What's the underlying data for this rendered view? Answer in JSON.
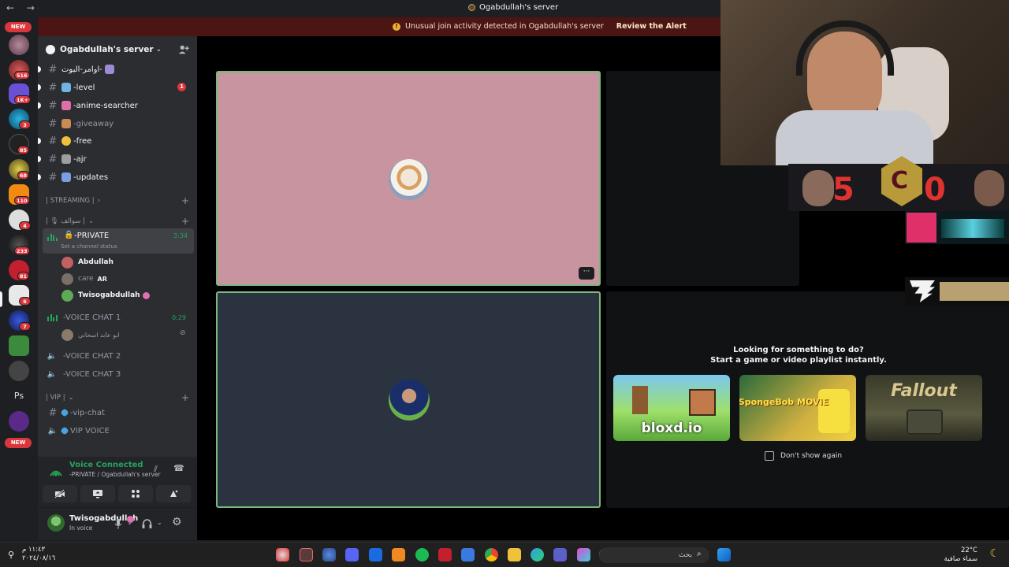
{
  "window": {
    "title": "Ogabdullah's server",
    "nav_arrows": "← →"
  },
  "alert": {
    "message": "Unusual join activity detected in Ogabdullah's server",
    "action": "Review the Alert"
  },
  "rail": {
    "badges": [
      "516",
      "1K+",
      "3",
      "85",
      "68",
      "110",
      "4",
      "233",
      "81",
      "6",
      "7"
    ],
    "new_label": "NEW",
    "ps_label": "Ps"
  },
  "sidebar": {
    "server_name": "Ogabdullah's server",
    "channels": [
      {
        "label": "اوامر-البوت-",
        "color": "#9e8bd6"
      },
      {
        "label": "-level",
        "color": "#6fb3e0",
        "mention": "1"
      },
      {
        "label": "-anime-searcher",
        "color": "#e06fa8"
      },
      {
        "label": "-giveaway",
        "color": "#c98a55"
      },
      {
        "label": "-free",
        "color": "#f0c23a"
      },
      {
        "label": "-ajr",
        "color": "#9e9e9e"
      },
      {
        "label": "-updates",
        "color": "#7a9ee0"
      }
    ],
    "categories": {
      "streaming": "| STREAMING |",
      "misc": "| 🎙 سوالف |",
      "vip": "| VIP |"
    },
    "private_channel": {
      "label": "-PRIVATE",
      "status_hint": "Set a channel status",
      "timer": "3:34"
    },
    "private_members": [
      {
        "name": "Abdullah",
        "color": "#c46060"
      },
      {
        "name": "care",
        "tag": "AR",
        "color": "#7a6f66"
      },
      {
        "name": "Twisogabdullah",
        "color": "#5faa55"
      }
    ],
    "voice_chat_1": {
      "label": "-VOICE CHAT 1",
      "timer": "0:29"
    },
    "voice_chat_1_member": "ابو عابد اسحاني",
    "voice_chat_2": "-VOICE CHAT 2",
    "voice_chat_3": "-VOICE CHAT 3",
    "vip_chat": "-vip-chat",
    "vip_voice": "VIP VOICE"
  },
  "voice_panel": {
    "title": "Voice Connected",
    "subtitle": "-PRIVATE / Ogabdullah's server"
  },
  "user_panel": {
    "name": "Twisogabdullah",
    "status": "In voice"
  },
  "stage": {
    "activity_line1": "Looking for something to do?",
    "activity_line2": "Start a game or video playlist instantly.",
    "games": [
      "bloxd.io",
      "SpongeBob MOVIE",
      "Fallout"
    ],
    "dont_show": "Don't show again",
    "more_label": "···"
  },
  "overlay": {
    "score_left": "5",
    "score_right": "0"
  },
  "taskbar": {
    "time": "١١:٤٣ م",
    "date": "٢٠٢٤/٠٨/١٦",
    "search_placeholder": "بحث",
    "temperature": "22°C",
    "weather": "سماء صافية"
  },
  "colors": {
    "accent_green": "#23a55a",
    "alert_bg": "#4a1512",
    "mention_red": "#da373c"
  }
}
